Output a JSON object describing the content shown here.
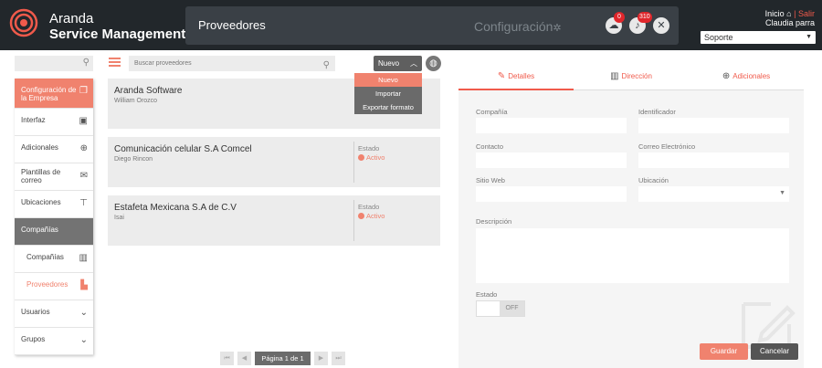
{
  "brand": {
    "line1": "Aranda",
    "line2": "Service Management",
    "accent": "#f05a4b"
  },
  "header": {
    "title": "Proveedores",
    "config_label": "Configuración",
    "cloud_badge": "0",
    "bell_badge": "310",
    "home_link": "Inicio",
    "separator": "|",
    "logout_link": "Salir",
    "user_name": "Claudia parra",
    "profile_value": "Soporte"
  },
  "sidebar": {
    "items": [
      {
        "label": "Configuración de la Empresa",
        "icon": "copy-icon"
      },
      {
        "label": "Interfaz",
        "icon": "monitor-icon"
      },
      {
        "label": "Adicionales",
        "icon": "plus-circle-icon"
      },
      {
        "label": "Plantillas de correo",
        "icon": "envelope-icon"
      },
      {
        "label": "Ubicaciones",
        "icon": "signpost-icon"
      },
      {
        "label": "Compañías",
        "icon": ""
      },
      {
        "label": "Compañías",
        "icon": "building-icon"
      },
      {
        "label": "Proveedores",
        "icon": "factory-icon"
      },
      {
        "label": "Usuarios",
        "icon": "chevron-down-icon"
      },
      {
        "label": "Grupos",
        "icon": "chevron-down-icon"
      }
    ]
  },
  "list": {
    "search_placeholder": "Buscar proveedores",
    "new_button": "Nuevo",
    "dropdown": [
      "Nuevo",
      "Importar",
      "Exportar formato"
    ],
    "cards": [
      {
        "name": "Aranda Software",
        "contact": "William Orozco",
        "status_label": "",
        "status": ""
      },
      {
        "name": "Comunicación celular S.A Comcel",
        "contact": "Diego Rincon",
        "status_label": "Estado",
        "status": "Activo"
      },
      {
        "name": "Estafeta Mexicana S.A de C.V",
        "contact": "Isai",
        "status_label": "Estado",
        "status": "Activo"
      }
    ],
    "pager_label": "Página 1 de 1"
  },
  "form": {
    "tabs": [
      "Detalles",
      "Dirección",
      "Adicionales"
    ],
    "company_label": "Compañía",
    "identifier_label": "Identificador",
    "contact_label": "Contacto",
    "email_label": "Correo Electrónico",
    "website_label": "Sitio Web",
    "location_label": "Ubicación",
    "description_label": "Descripción",
    "status_label": "Estado",
    "toggle_off": "OFF",
    "save_button": "Guardar",
    "cancel_button": "Cancelar"
  }
}
